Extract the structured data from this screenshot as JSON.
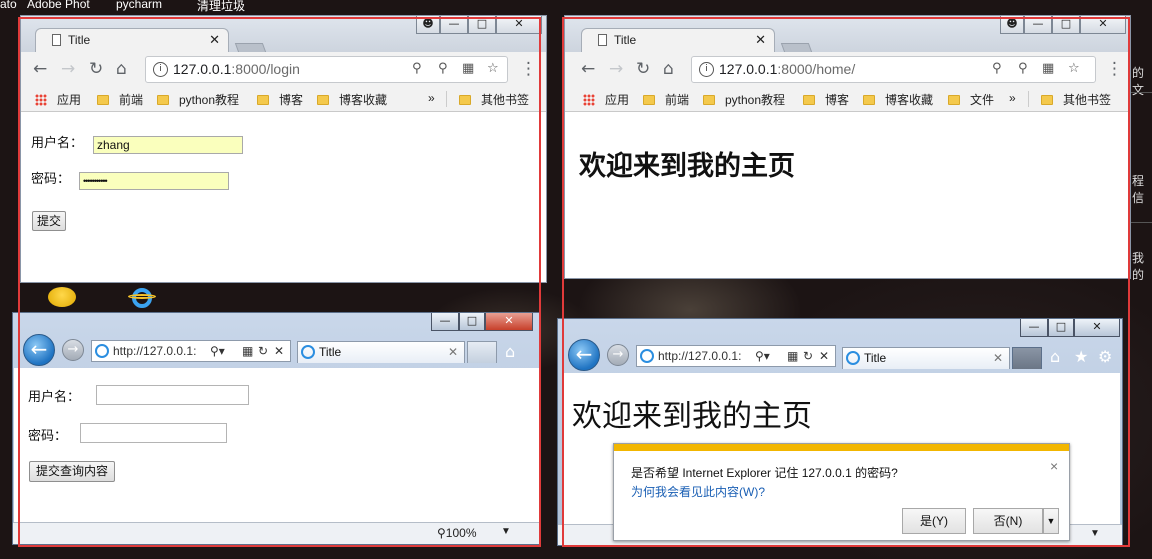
{
  "desktop": {
    "top_labels": [
      "ato",
      "Adobe Phot",
      "pycharm",
      "清理垃圾"
    ],
    "right_edge_fragments": [
      "的文",
      "程信",
      "我的"
    ]
  },
  "chrome_login": {
    "tab_title": "Title",
    "url_host": "127.0.0.1",
    "url_path": ":8000/login",
    "bookmarks": [
      "应用",
      "前端",
      "python教程",
      "博客",
      "博客收藏",
      "»",
      "其他书签"
    ],
    "form": {
      "username_label": "用户名：",
      "username_value": "zhang",
      "password_label": "密码：",
      "password_value": "•••••••••••",
      "submit_label": "提交"
    }
  },
  "chrome_home": {
    "tab_title": "Title",
    "url_host": "127.0.0.1",
    "url_path": ":8000/home/",
    "bookmarks": [
      "应用",
      "前端",
      "python教程",
      "博客",
      "博客收藏",
      "文件",
      "»",
      "其他书签"
    ],
    "heading": "欢迎来到我的主页"
  },
  "ie_login": {
    "address": "http://127.0.0.1:",
    "tab_title": "Title",
    "form": {
      "username_label": "用户名：",
      "password_label": "密码：",
      "submit_label": "提交查询内容"
    },
    "zoom": "100%"
  },
  "ie_home": {
    "address": "http://127.0.0.1:",
    "tab_title": "Title",
    "heading": "欢迎来到我的主页",
    "dialog": {
      "question": "是否希望 Internet Explorer 记住 127.0.0.1 的密码?",
      "link": "为何我会看见此内容(W)?",
      "yes_label": "是(Y)",
      "no_label": "否(N)",
      "close": "×"
    }
  }
}
